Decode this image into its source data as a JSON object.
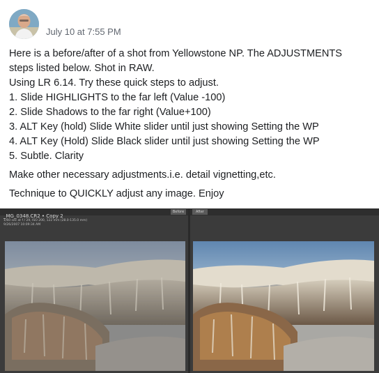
{
  "post": {
    "timestamp": "July 10 at 7:55 PM",
    "lines": [
      "Here is a before/after of a shot from Yellowstone NP. The ADJUSTMENTS",
      "steps listed below. Shot in RAW.",
      "Using LR 6.14. Try these quick steps to adjust.",
      "1. Slide HIGHLIGHTS to the far left (Value -100)",
      "2. Slide Shadows to the far right (Value+100)",
      "3. ALT Key (hold) Slide White slider until just showing Setting the WP",
      "4. ALT Key (Hold) Slide Black slider until just showing Setting the WP",
      "5. Subtle. Clarity"
    ],
    "paragraph2": "Make other necessary adjustments.i.e. detail vignetting,etc.",
    "paragraph3": "Technique to QUICKLY adjust any image. Enjoy"
  },
  "image": {
    "filename": "_MG_0348.CR2 • Copy 2",
    "exif_line1": "1/60 sec at f / 29, ISO 200, 122 mm (28.0-135.0 mm)",
    "exif_line2": "9/26/2007 10:09:34 AM",
    "before_tag": "Before",
    "after_tag": "After"
  }
}
